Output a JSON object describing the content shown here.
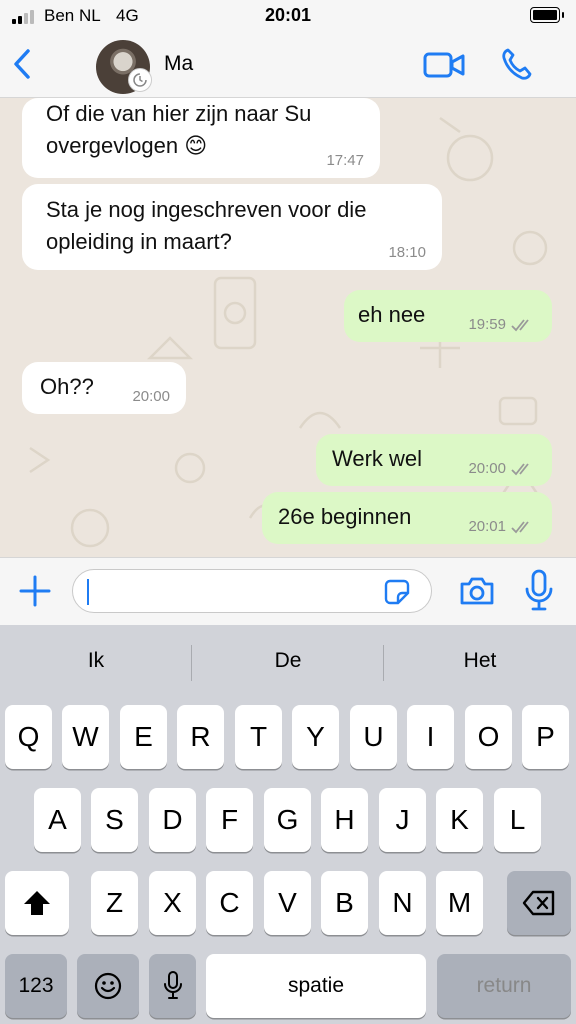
{
  "status_bar": {
    "carrier": "Ben NL",
    "network": "4G",
    "time": "20:01"
  },
  "header": {
    "contact_name": "Ma"
  },
  "messages": [
    {
      "direction": "in",
      "text": "Of die van hier zijn naar Su\novergevlogen 😊",
      "time": "17:47"
    },
    {
      "direction": "in",
      "text": "Sta je nog ingeschreven voor die\nopleiding in maart?",
      "time": "18:10"
    },
    {
      "direction": "out",
      "text": "eh nee",
      "time": "19:59"
    },
    {
      "direction": "in",
      "text": "Oh??",
      "time": "20:00"
    },
    {
      "direction": "out",
      "text": "Werk wel",
      "time": "20:00"
    },
    {
      "direction": "out",
      "text": "26e beginnen",
      "time": "20:01"
    }
  ],
  "composer": {
    "value": "",
    "placeholder": ""
  },
  "keyboard": {
    "suggestions": [
      "Ik",
      "De",
      "Het"
    ],
    "row1": [
      "Q",
      "W",
      "E",
      "R",
      "T",
      "Y",
      "U",
      "I",
      "O",
      "P"
    ],
    "row2": [
      "A",
      "S",
      "D",
      "F",
      "G",
      "H",
      "J",
      "K",
      "L"
    ],
    "row3": [
      "Z",
      "X",
      "C",
      "V",
      "B",
      "N",
      "M"
    ],
    "numbers_key": "123",
    "space_key": "spatie",
    "return_key": "return"
  },
  "colors": {
    "accent": "#1f7cf3",
    "outgoing_bubble": "#dcf8c6",
    "chat_background": "#ece5dd"
  },
  "icons": [
    "back-chevron-icon",
    "video-call-icon",
    "phone-icon",
    "plus-icon",
    "sticker-icon",
    "camera-icon",
    "microphone-icon",
    "shift-icon",
    "backspace-icon",
    "emoji-icon",
    "dictation-icon"
  ]
}
